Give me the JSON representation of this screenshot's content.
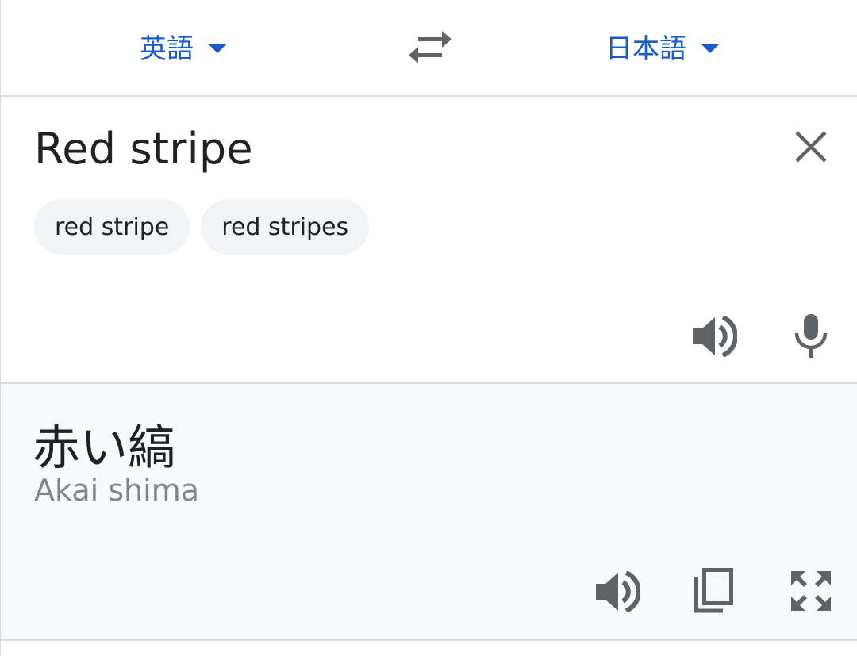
{
  "language_bar": {
    "source_language": "英語",
    "target_language": "日本語",
    "swap_icon": "swap-arrows-icon"
  },
  "source": {
    "text": "Red stripe",
    "suggestions": [
      "red stripe",
      "red stripes"
    ],
    "icons": [
      "close-icon",
      "speaker-icon",
      "microphone-icon"
    ]
  },
  "result": {
    "text": "赤い縞",
    "romanization": "Akai shima",
    "icons": [
      "speaker-icon",
      "copy-icon",
      "fullscreen-icon"
    ]
  },
  "colors": {
    "accent": "#1a5bc8",
    "icon_gray": "#5f6368",
    "divider": "#dadce0",
    "result_bg": "#f8f9fa",
    "chip_bg": "#f1f3f4",
    "romanization": "#80868b"
  }
}
